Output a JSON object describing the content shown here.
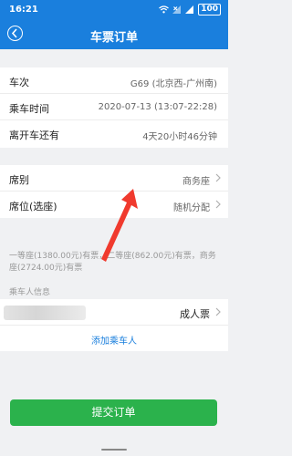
{
  "status_bar": {
    "time": "16:21",
    "battery": "100"
  },
  "header": {
    "title": "车票订单"
  },
  "train_info": {
    "train_label": "车次",
    "train_value": "G69 (北京西-广州南)",
    "time_label": "乘车时间",
    "time_value": "2020-07-13 (13:07-22:28)",
    "countdown_label": "离开车还有",
    "countdown_value": "4天20小时46分钟"
  },
  "seat": {
    "class_label": "席别",
    "class_value": "商务座",
    "position_label": "席位(选座)",
    "position_value": "随机分配"
  },
  "availability_note": "一等座(1380.00元)有票，二等座(862.00元)有票，商务座(2724.00元)有票",
  "passengers": {
    "section_label": "乘车人信息",
    "items": [
      {
        "ticket_type": "成人票"
      }
    ],
    "add_label": "添加乘车人"
  },
  "submit": {
    "label": "提交订单"
  },
  "colors": {
    "primary": "#1a7fdd",
    "submit": "#2bb24c",
    "annotation_arrow": "#f03a2e"
  }
}
